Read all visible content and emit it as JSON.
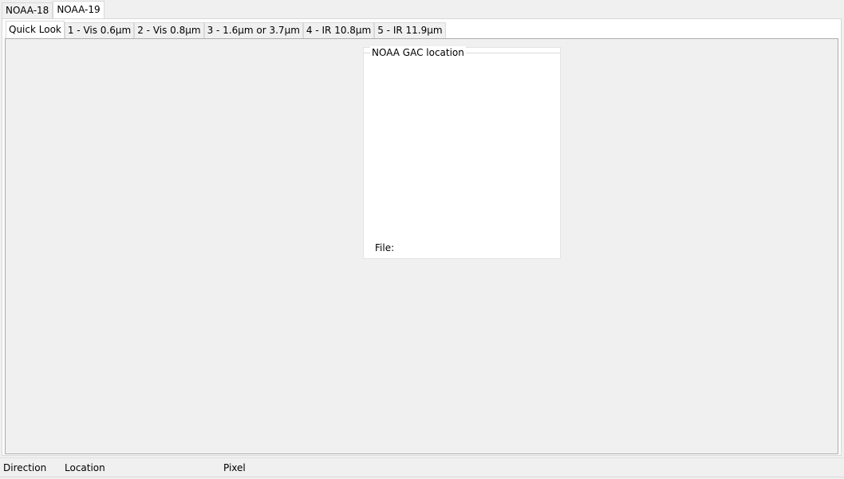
{
  "satellite_tabs": [
    "NOAA-18",
    "NOAA-19"
  ],
  "active_satellite_tab": "NOAA-19",
  "band_tabs": [
    "Quick Look",
    "1 - Vis 0.6µm",
    "2 - Vis 0.8µm",
    "3 - 1.6µm or 3.7µm",
    "4 - IR 10.8µm",
    "5 - IR 11.9µm"
  ],
  "active_band_tab": "Quick Look",
  "location_group": {
    "title": "NOAA GAC location",
    "file_label": "File:"
  },
  "status_bar": {
    "direction": "Direction",
    "location": "Location",
    "pixel": "Pixel"
  },
  "colors": {
    "window_background": "#f0f0f0",
    "panel_background": "#ffffff",
    "border": "#d9d9d9"
  }
}
